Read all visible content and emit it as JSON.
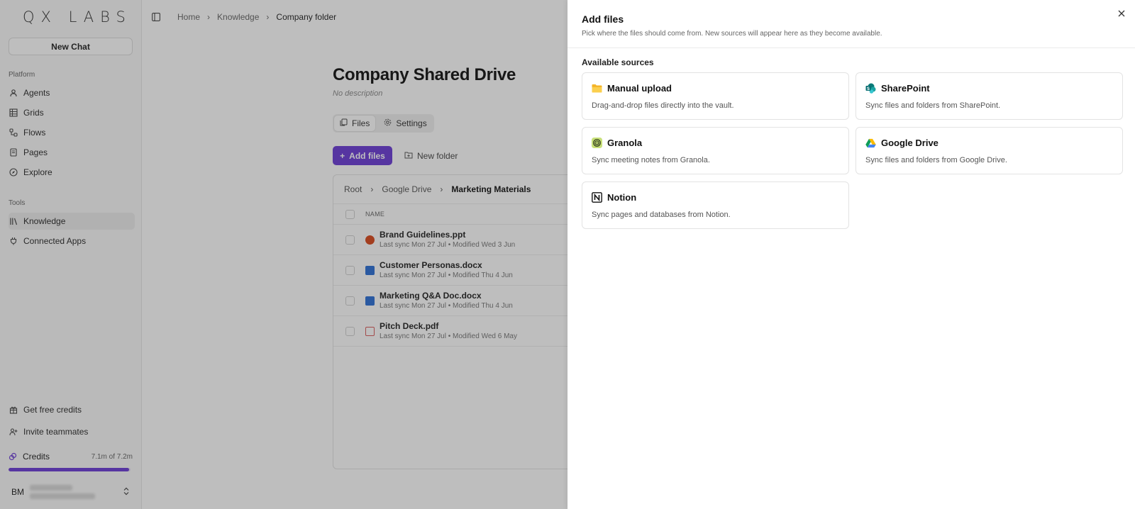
{
  "sidebar": {
    "logo": "QX LABS",
    "new_chat": "New Chat",
    "platform_label": "Platform",
    "platform_items": [
      "Agents",
      "Grids",
      "Flows",
      "Pages",
      "Explore"
    ],
    "tools_label": "Tools",
    "tools_items": [
      "Knowledge",
      "Connected Apps"
    ],
    "get_credits": "Get free credits",
    "invite": "Invite teammates",
    "credits_label": "Credits",
    "credits_amount": "7.1m of 7.2m",
    "credits_fraction": 0.986,
    "user_initials": "BM"
  },
  "breadcrumb": {
    "home": "Home",
    "knowledge": "Knowledge",
    "current": "Company folder"
  },
  "page": {
    "title": "Company Shared Drive",
    "description": "No description",
    "tab_files": "Files",
    "tab_settings": "Settings",
    "add_files": "Add files",
    "new_folder": "New folder"
  },
  "files": {
    "crumbs": [
      "Root",
      "Google Drive",
      "Marketing Materials"
    ],
    "column_name": "NAME",
    "rows": [
      {
        "name": "Brand Guidelines.ppt",
        "meta": "Last sync Mon 27 Jul • Modified Wed 3 Jun"
      },
      {
        "name": "Customer Personas.docx",
        "meta": "Last sync Mon 27 Jul • Modified Thu 4 Jun"
      },
      {
        "name": "Marketing Q&A Doc.docx",
        "meta": "Last sync Mon 27 Jul • Modified Thu 4 Jun"
      },
      {
        "name": "Pitch Deck.pdf",
        "meta": "Last sync Mon 27 Jul • Modified Wed 6 May"
      }
    ]
  },
  "drawer": {
    "title": "Add files",
    "subtitle": "Pick where the files should come from. New sources will appear here as they become available.",
    "section": "Available sources",
    "sources": [
      {
        "name": "Manual upload",
        "desc": "Drag-and-drop files directly into the vault.",
        "icon": "folder-icon"
      },
      {
        "name": "SharePoint",
        "desc": "Sync files and folders from SharePoint.",
        "icon": "sharepoint-icon"
      },
      {
        "name": "Granola",
        "desc": "Sync meeting notes from Granola.",
        "icon": "granola-icon"
      },
      {
        "name": "Google Drive",
        "desc": "Sync files and folders from Google Drive.",
        "icon": "google-drive-icon"
      },
      {
        "name": "Notion",
        "desc": "Sync pages and databases from Notion.",
        "icon": "notion-icon"
      }
    ]
  },
  "colors": {
    "accent": "#6a3bd6"
  }
}
